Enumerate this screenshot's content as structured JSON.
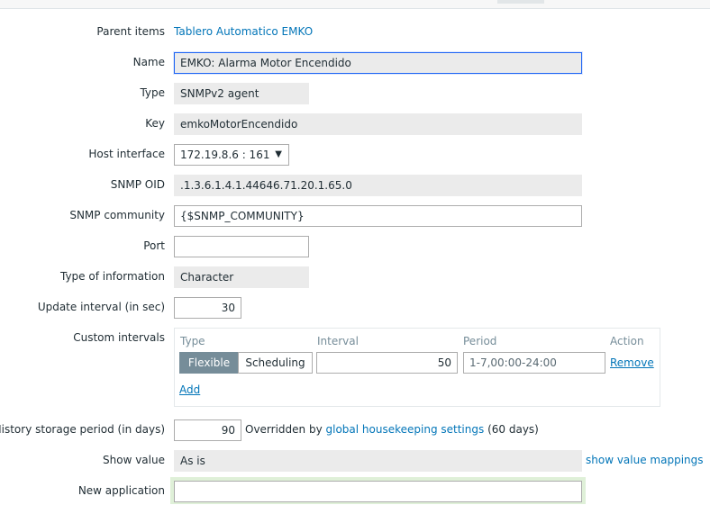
{
  "form": {
    "parent_items": {
      "label": "Parent items",
      "link": "Tablero Automatico EMKO"
    },
    "name": {
      "label": "Name",
      "value": "EMKO: Alarma Motor Encendido"
    },
    "type": {
      "label": "Type",
      "value": "SNMPv2 agent"
    },
    "key": {
      "label": "Key",
      "value": "emkoMotorEncendido"
    },
    "host_interface": {
      "label": "Host interface",
      "value": "172.19.8.6 : 161"
    },
    "snmp_oid": {
      "label": "SNMP OID",
      "value": ".1.3.6.1.4.1.44646.71.20.1.65.0"
    },
    "snmp_community": {
      "label": "SNMP community",
      "value": "{$SNMP_COMMUNITY}"
    },
    "port": {
      "label": "Port",
      "value": ""
    },
    "type_of_information": {
      "label": "Type of information",
      "value": "Character"
    },
    "update_interval": {
      "label": "Update interval (in sec)",
      "value": "30"
    },
    "custom_intervals": {
      "label": "Custom intervals",
      "headers": {
        "type": "Type",
        "interval": "Interval",
        "period": "Period",
        "action": "Action"
      },
      "row": {
        "flexible": "Flexible",
        "scheduling": "Scheduling",
        "interval": "50",
        "period": "1-7,00:00-24:00",
        "remove": "Remove"
      },
      "add": "Add"
    },
    "history": {
      "label": "History storage period (in days)",
      "value": "90",
      "note_prefix": "Overridden by",
      "note_link": "global housekeeping settings",
      "note_suffix": "(60 days)"
    },
    "show_value": {
      "label": "Show value",
      "value": "As is",
      "link": "show value mappings"
    },
    "new_application": {
      "label": "New application",
      "value": ""
    }
  },
  "colors": {
    "link": "#0275b8",
    "readonly_bg": "#ebebeb",
    "focus_border": "#1f65f4",
    "segment_active": "#768d99",
    "new_app_highlight": "#dff0d8"
  }
}
